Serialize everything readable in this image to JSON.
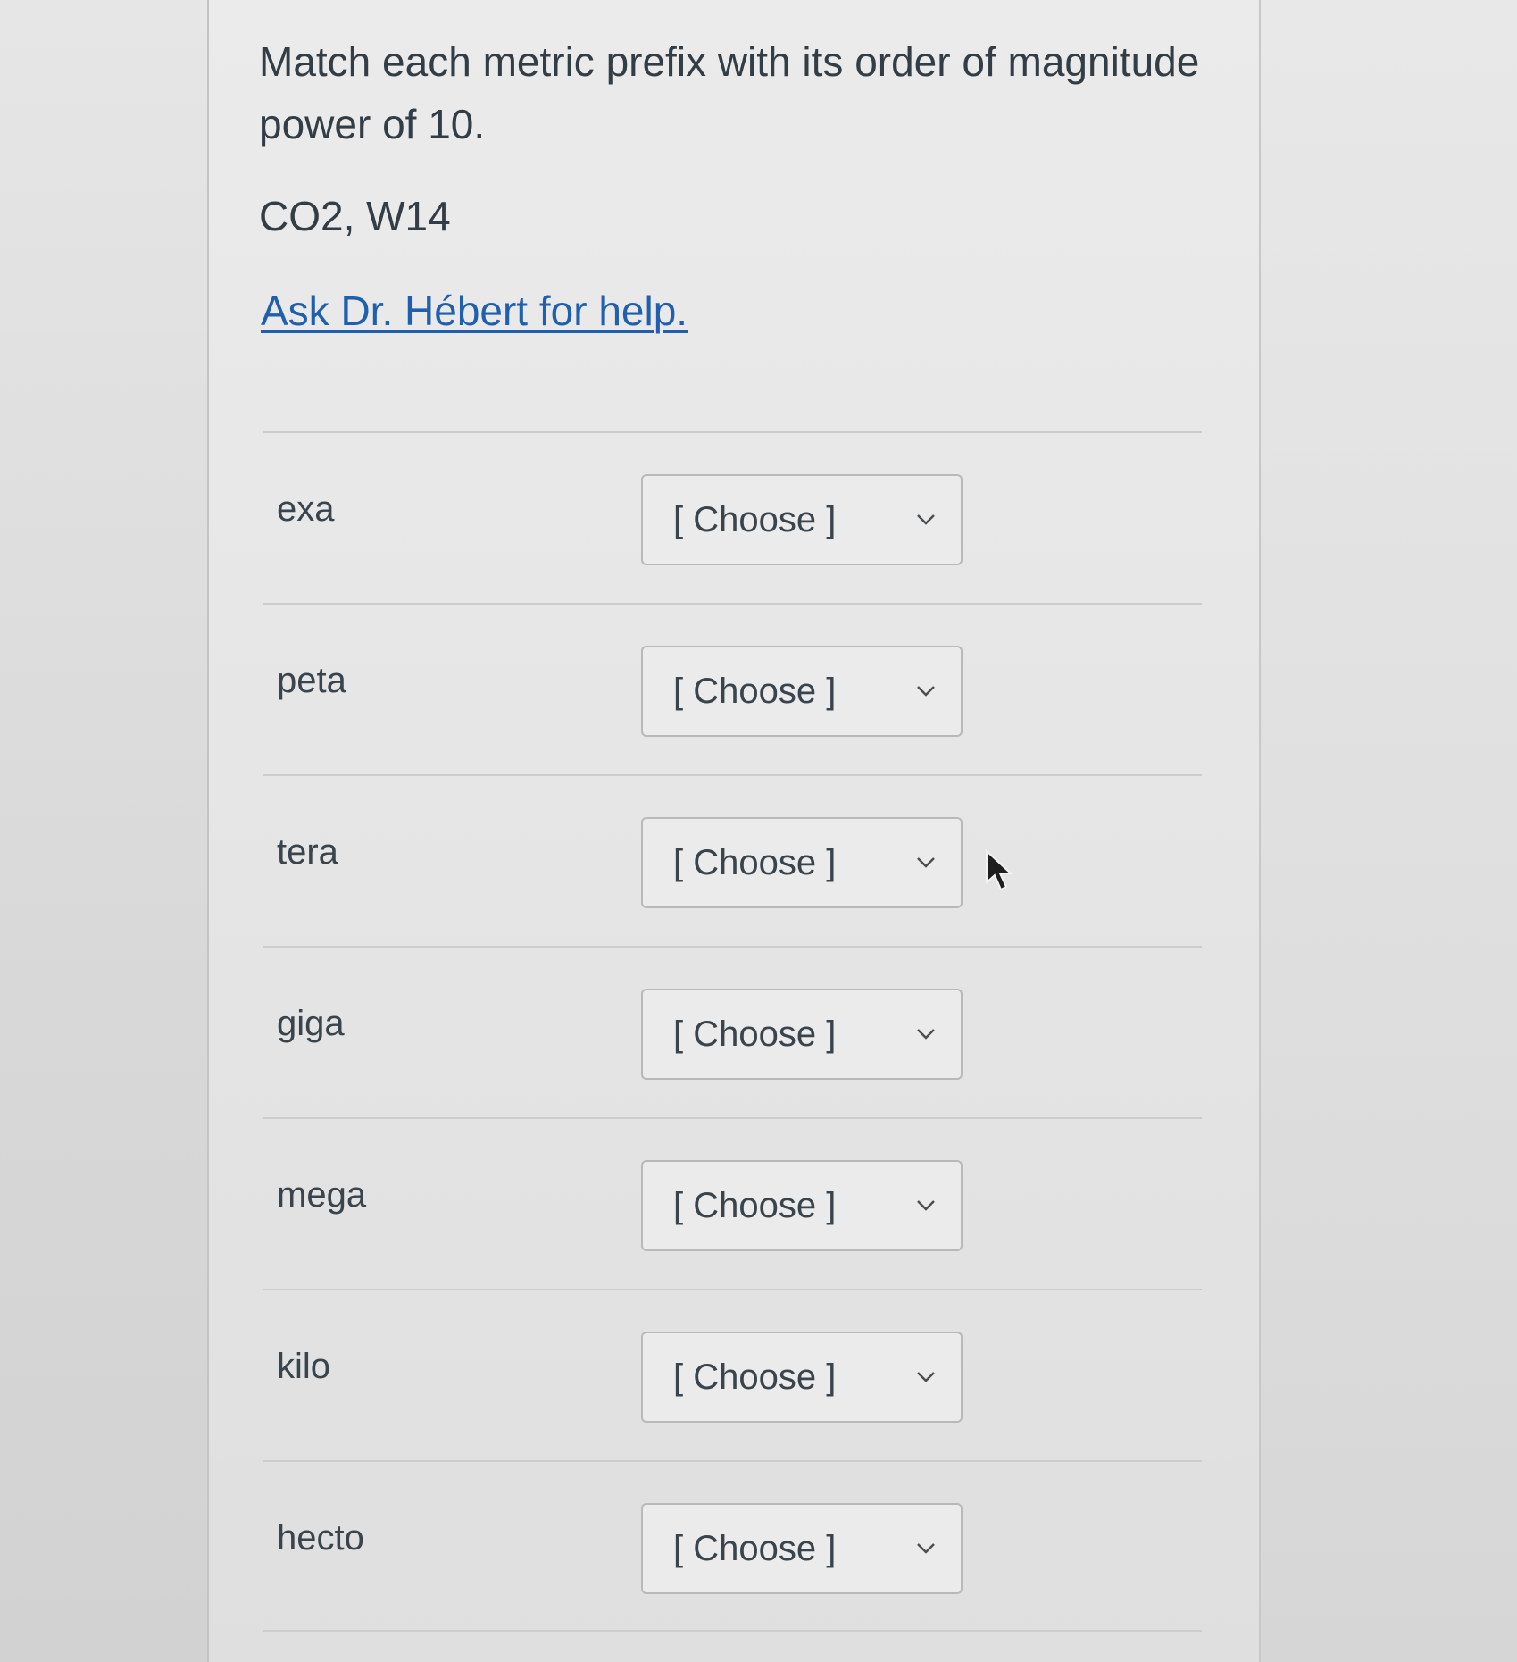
{
  "question": {
    "text": "Match each metric prefix with its order of magnitude power of 10.",
    "course_code": "CO2, W14",
    "help_link": "Ask Dr. Hébert for help."
  },
  "matches": [
    {
      "prefix": "exa",
      "selected": "[ Choose ]"
    },
    {
      "prefix": "peta",
      "selected": "[ Choose ]"
    },
    {
      "prefix": "tera",
      "selected": "[ Choose ]"
    },
    {
      "prefix": "giga",
      "selected": "[ Choose ]"
    },
    {
      "prefix": "mega",
      "selected": "[ Choose ]"
    },
    {
      "prefix": "kilo",
      "selected": "[ Choose ]"
    },
    {
      "prefix": "hecto",
      "selected": "[ Choose ]"
    }
  ],
  "icons": {
    "dropdown": "chevron-down-icon",
    "pointer": "mouse-cursor-icon"
  },
  "colors": {
    "link": "#1f5fae",
    "text": "#333d45",
    "divider": "#cdcdcd"
  }
}
